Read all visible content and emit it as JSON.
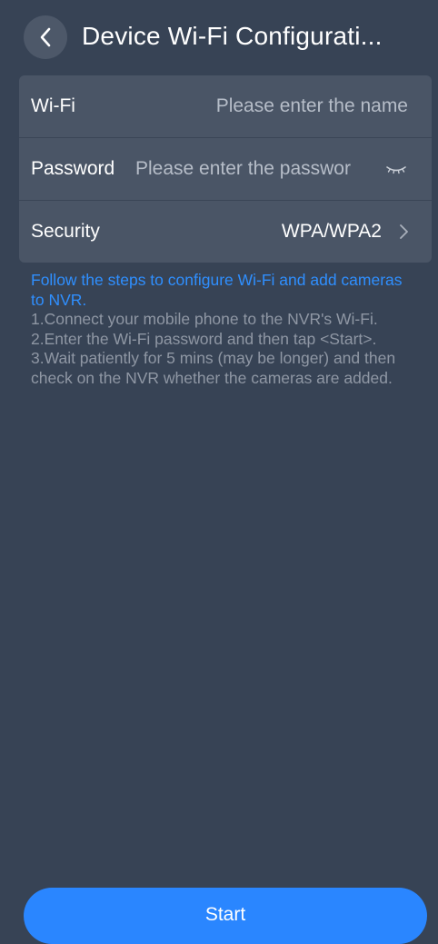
{
  "header": {
    "back_icon": "chevron-left-icon",
    "title": "Device Wi-Fi Configurati..."
  },
  "form": {
    "wifi": {
      "label": "Wi-Fi",
      "placeholder": "Please enter the name",
      "value": ""
    },
    "password": {
      "label": "Password",
      "placeholder": "Please enter the passwor",
      "value": "",
      "visibility_icon": "eye-closed-icon"
    },
    "security": {
      "label": "Security",
      "value": "WPA/WPA2",
      "icon": "chevron-right-icon"
    }
  },
  "instructions": {
    "lead": "Follow the steps to configure Wi-Fi and add cameras to NVR.",
    "steps": [
      "1.Connect your mobile phone to the NVR's Wi-Fi.",
      "2.Enter the Wi-Fi password and then tap <Start>.",
      "3.Wait patiently for 5 mins (may be longer) and then check on the NVR whether the cameras are added."
    ]
  },
  "footer": {
    "start_label": "Start"
  },
  "colors": {
    "background": "#374355",
    "card": "#4a5566",
    "accent": "#2a86ff",
    "link": "#2f8fff",
    "muted_text": "#8f97a4"
  }
}
